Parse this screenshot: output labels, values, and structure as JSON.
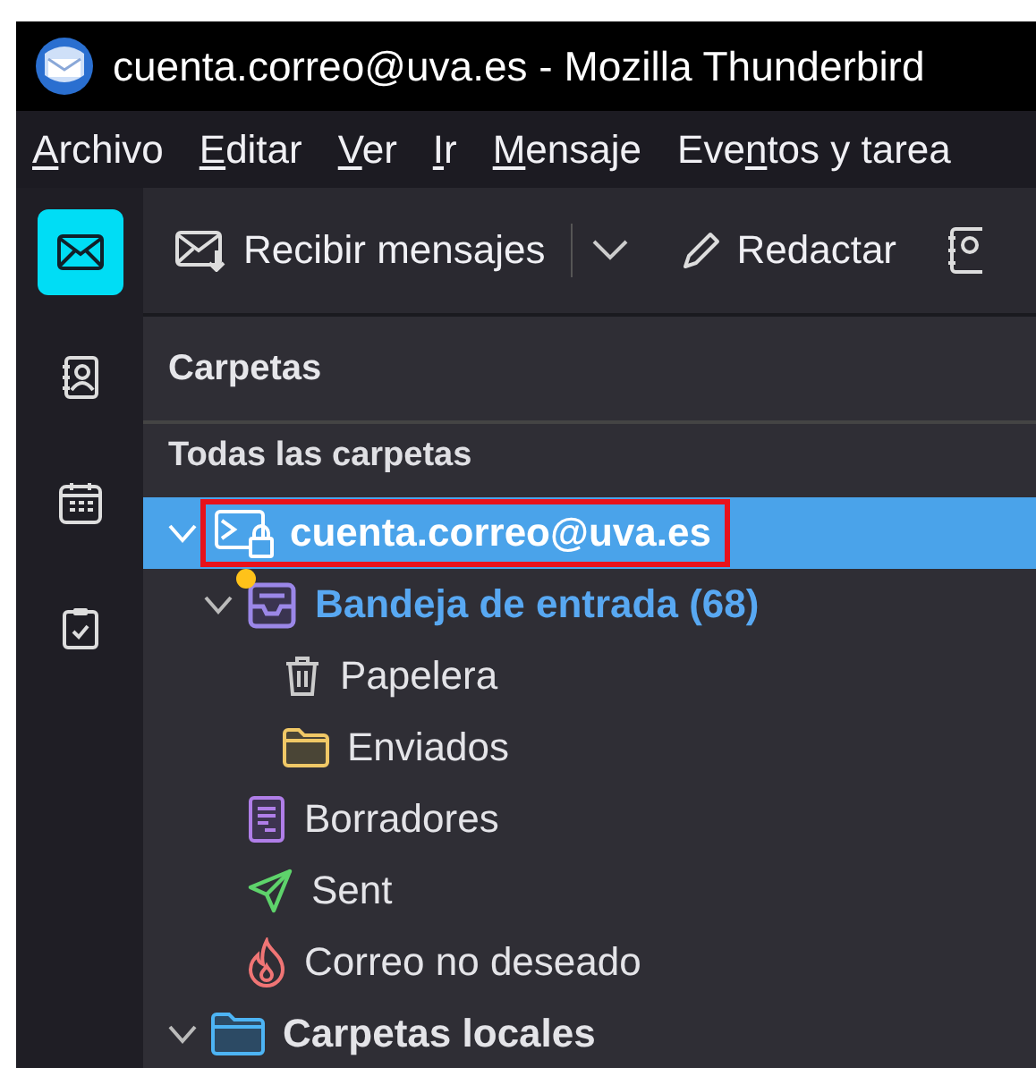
{
  "window": {
    "title": "cuenta.correo@uva.es - Mozilla Thunderbird"
  },
  "menu": [
    {
      "key": "A",
      "after": "rchivo"
    },
    {
      "key": "E",
      "after": "ditar"
    },
    {
      "key": "V",
      "after": "er"
    },
    {
      "key": "I",
      "after": "r"
    },
    {
      "key": "M",
      "after": "ensaje"
    },
    {
      "before": "Eve",
      "key": "n",
      "after": "tos y tarea"
    }
  ],
  "spaces": [
    {
      "kind": "mail",
      "selected": true
    },
    {
      "kind": "contacts",
      "selected": false
    },
    {
      "kind": "calendar",
      "selected": false
    },
    {
      "kind": "tasks",
      "selected": false
    }
  ],
  "toolbar": {
    "get_messages": "Recibir mensajes",
    "compose": "Redactar"
  },
  "folder_pane": {
    "title": "Carpetas",
    "mode": "Todas las carpetas",
    "tree": [
      {
        "kind": "account",
        "name": "cuenta.correo@uva.es",
        "selected": true,
        "outlined": true,
        "unread": false,
        "new_mail": false,
        "expanded": true,
        "children": [
          {
            "kind": "inbox",
            "name": "Bandeja de entrada (68)",
            "selected": false,
            "outlined": false,
            "unread": true,
            "new_mail": true,
            "expanded": true,
            "children": [
              {
                "kind": "trash",
                "name": "Papelera",
                "selected": false,
                "outlined": false,
                "unread": false,
                "new_mail": false
              },
              {
                "kind": "folder",
                "name": "Enviados",
                "selected": false,
                "outlined": false,
                "unread": false,
                "new_mail": false
              }
            ]
          },
          {
            "kind": "drafts",
            "name": "Borradores",
            "selected": false,
            "outlined": false,
            "unread": false,
            "new_mail": false
          },
          {
            "kind": "sent",
            "name": "Sent",
            "selected": false,
            "outlined": false,
            "unread": false,
            "new_mail": false
          },
          {
            "kind": "junk",
            "name": "Correo no deseado",
            "selected": false,
            "outlined": false,
            "unread": false,
            "new_mail": false
          }
        ]
      },
      {
        "kind": "local",
        "name": "Carpetas locales",
        "selected": false,
        "outlined": false,
        "unread": false,
        "new_mail": false,
        "expanded": true
      }
    ]
  }
}
